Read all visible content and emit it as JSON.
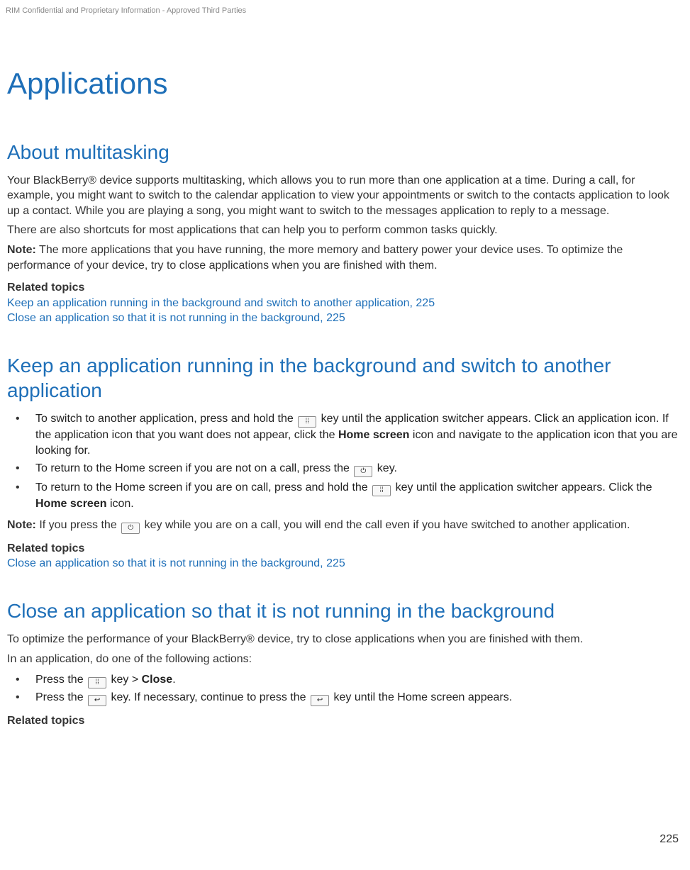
{
  "header": {
    "confidential": "RIM Confidential and Proprietary Information - Approved Third Parties"
  },
  "page_number": "225",
  "h1": "Applications",
  "section1": {
    "title": "About multitasking",
    "p1": "Your BlackBerry® device supports multitasking, which allows you to run more than one application at a time. During a call, for example, you might want to switch to the calendar application to view your appointments or switch to the contacts application to look up a contact. While you are playing a song, you might want to switch to the messages application to reply to a message.",
    "p2": "There are also shortcuts for most applications that can help you to perform common tasks quickly.",
    "note_label": "Note:",
    "note_text": " The more applications that you have running, the more memory and battery power your device uses. To optimize the performance of your device, try to close applications when you are finished with them.",
    "related_head": "Related topics",
    "link1": "Keep an application running in the background and switch to another application, 225",
    "link2": "Close an application so that it is not running in the background, 225"
  },
  "section2": {
    "title": "Keep an application running in the background and switch to another application",
    "b1a": "To switch to another application, press and hold the ",
    "b1b": " key until the application switcher appears. Click an application icon. If the application icon that you want does not appear, click the ",
    "home_screen": "Home screen",
    "b1c": " icon and navigate to the application icon that you are looking for.",
    "b2a": "To return to the Home screen if you are not on a call, press the ",
    "b2b": " key.",
    "b3a": "To return to the Home screen if you are on call, press and hold the ",
    "b3b": " key until the application switcher appears. Click the ",
    "b3c": " icon.",
    "note_label": "Note:",
    "note_a": " If you press the ",
    "note_b": " key while you are on a call, you will end the call even if you have switched to another application.",
    "related_head": "Related topics",
    "link1": "Close an application so that it is not running in the background, 225"
  },
  "section3": {
    "title": "Close an application so that it is not running in the background",
    "p1": "To optimize the performance of your BlackBerry® device, try to close applications when you are finished with them.",
    "p2": "In an application, do one of the following actions:",
    "b1a": "Press the ",
    "b1b": " key > ",
    "close": "Close",
    "b1c": ".",
    "b2a": "Press the ",
    "b2b": " key. If necessary, continue to press the ",
    "b2c": " key until the Home screen appears.",
    "related_head": "Related topics"
  },
  "icons": {
    "menu": "⁞⁞",
    "end": "⏻",
    "back": "↩"
  }
}
